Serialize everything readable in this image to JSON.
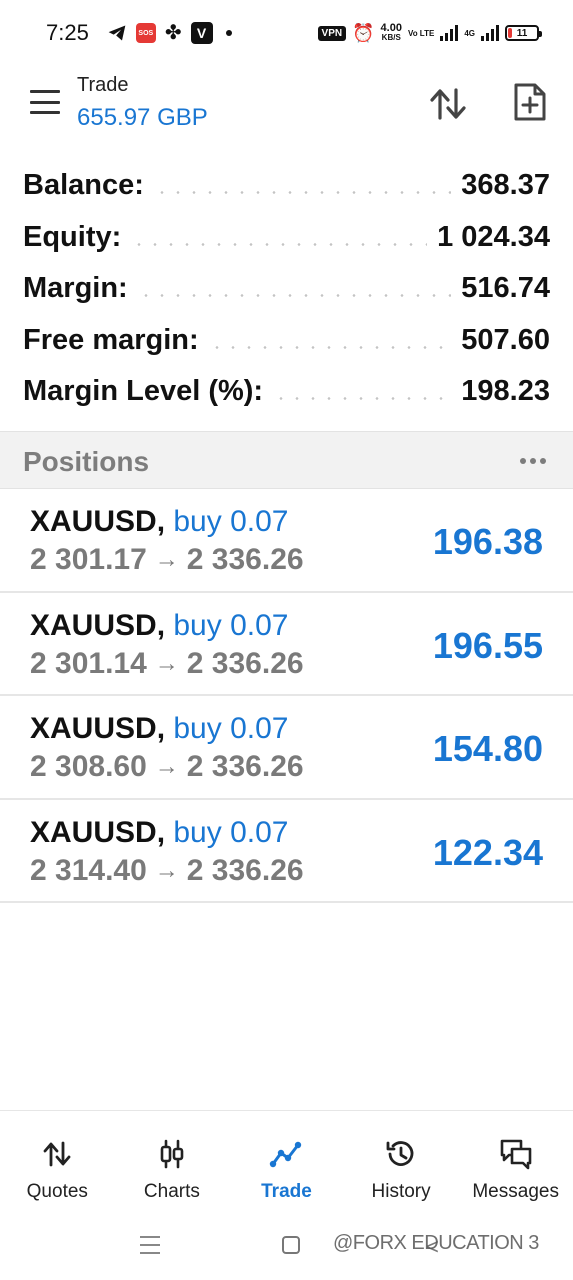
{
  "status_bar": {
    "time": "7:25",
    "vpn": "VPN",
    "speed_value": "4.00",
    "speed_unit": "KB/S",
    "volte": "Vo LTE",
    "network": "4G",
    "battery": "11",
    "sos_label": "SOS",
    "v_label": "V"
  },
  "header": {
    "title": "Trade",
    "subtitle": "655.97 GBP"
  },
  "summary": [
    {
      "label": "Balance:",
      "value": "368.37"
    },
    {
      "label": "Equity:",
      "value": "1 024.34"
    },
    {
      "label": "Margin:",
      "value": "516.74"
    },
    {
      "label": "Free margin:",
      "value": "507.60"
    },
    {
      "label": "Margin Level (%):",
      "value": "198.23"
    }
  ],
  "positions": {
    "label": "Positions",
    "items": [
      {
        "symbol": "XAUUSD",
        "side": "buy 0.07",
        "open_price": "2 301.17",
        "current_price": "2 336.26",
        "profit": "196.38"
      },
      {
        "symbol": "XAUUSD",
        "side": "buy 0.07",
        "open_price": "2 301.14",
        "current_price": "2 336.26",
        "profit": "196.55"
      },
      {
        "symbol": "XAUUSD",
        "side": "buy 0.07",
        "open_price": "2 308.60",
        "current_price": "2 336.26",
        "profit": "154.80"
      },
      {
        "symbol": "XAUUSD",
        "side": "buy 0.07",
        "open_price": "2 314.40",
        "current_price": "2 336.26",
        "profit": "122.34"
      }
    ]
  },
  "bottom_nav": [
    {
      "label": "Quotes",
      "icon": "quotes-icon"
    },
    {
      "label": "Charts",
      "icon": "charts-icon"
    },
    {
      "label": "Trade",
      "icon": "trade-icon",
      "active": true
    },
    {
      "label": "History",
      "icon": "history-icon"
    },
    {
      "label": "Messages",
      "icon": "messages-icon"
    }
  ],
  "watermark": "@FORX EDUCATION 3",
  "colors": {
    "accent": "#1976d2",
    "muted": "#7a7a7a",
    "section_bg": "#f2f2f2"
  }
}
